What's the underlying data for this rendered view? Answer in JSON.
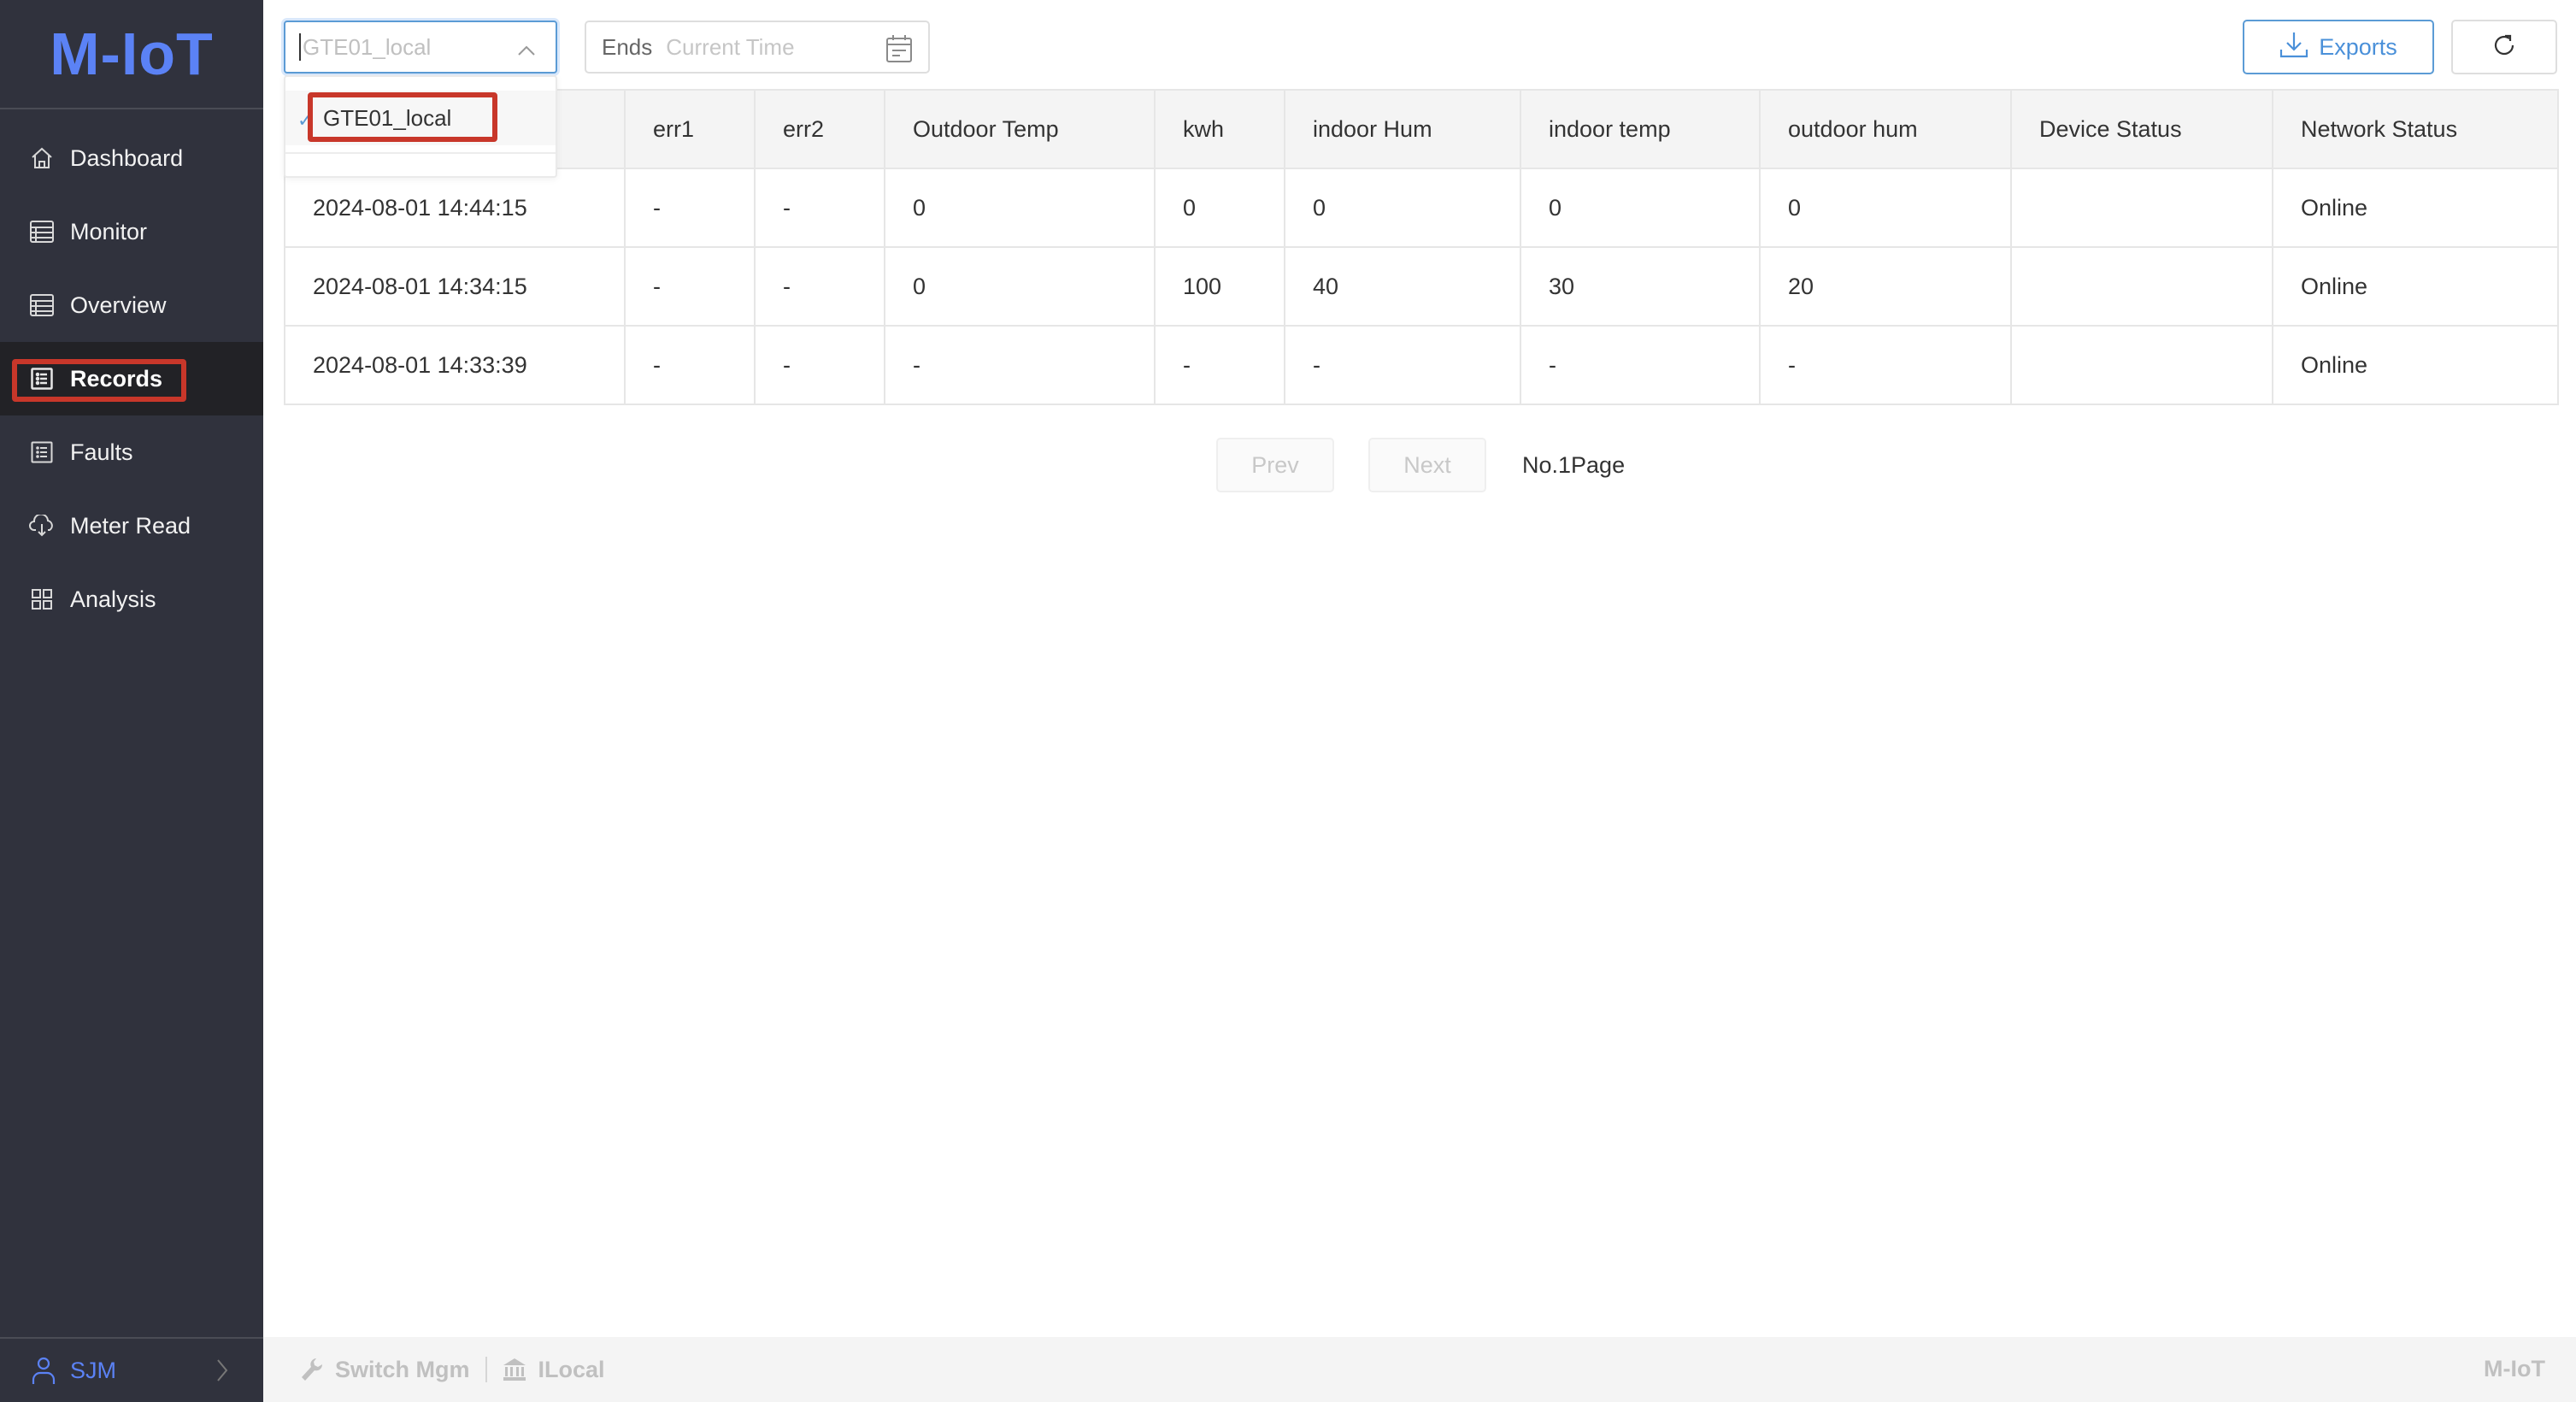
{
  "app": {
    "logo": "M-IoT"
  },
  "sidebar": {
    "items": [
      {
        "label": "Dashboard",
        "icon": "home-icon",
        "active": false
      },
      {
        "label": "Monitor",
        "icon": "list-table-icon",
        "active": false
      },
      {
        "label": "Overview",
        "icon": "list-table-icon",
        "active": false
      },
      {
        "label": "Records",
        "icon": "records-list-icon",
        "active": true
      },
      {
        "label": "Faults",
        "icon": "faults-list-icon",
        "active": false
      },
      {
        "label": "Meter Read",
        "icon": "cloud-download-icon",
        "active": false
      },
      {
        "label": "Analysis",
        "icon": "grid-icon",
        "active": false
      }
    ],
    "user": {
      "name": "SJM",
      "icon": "user-icon"
    }
  },
  "toolbar": {
    "device_select": {
      "placeholder": "GTE01_local",
      "open": true
    },
    "dropdown_options": [
      {
        "label": "GTE01_local",
        "selected": true
      }
    ],
    "end_time": {
      "label": "Ends",
      "placeholder": "Current Time"
    },
    "exports_label": "Exports",
    "refresh_icon": "refresh-icon"
  },
  "table": {
    "columns": [
      "",
      "err1",
      "err2",
      "Outdoor Temp",
      "kwh",
      "indoor Hum",
      "indoor temp",
      "outdoor hum",
      "Device Status",
      "Network Status"
    ],
    "rows": [
      [
        "2024-08-01 14:44:15",
        "-",
        "-",
        "0",
        "0",
        "0",
        "0",
        "0",
        "",
        "Online"
      ],
      [
        "2024-08-01 14:34:15",
        "-",
        "-",
        "0",
        "100",
        "40",
        "30",
        "20",
        "",
        "Online"
      ],
      [
        "2024-08-01 14:33:39",
        "-",
        "-",
        "-",
        "-",
        "-",
        "-",
        "-",
        "",
        "Online"
      ]
    ]
  },
  "pagination": {
    "prev": "Prev",
    "next": "Next",
    "page_label": "No.1Page"
  },
  "footer": {
    "switch_mgm": "Switch Mgm",
    "local": "ILocal",
    "brand": "M-IoT"
  },
  "colors": {
    "accent": "#5b82f5",
    "sidebar_bg": "#30323d",
    "highlight": "#c8372a",
    "link_blue": "#4a90d9"
  }
}
